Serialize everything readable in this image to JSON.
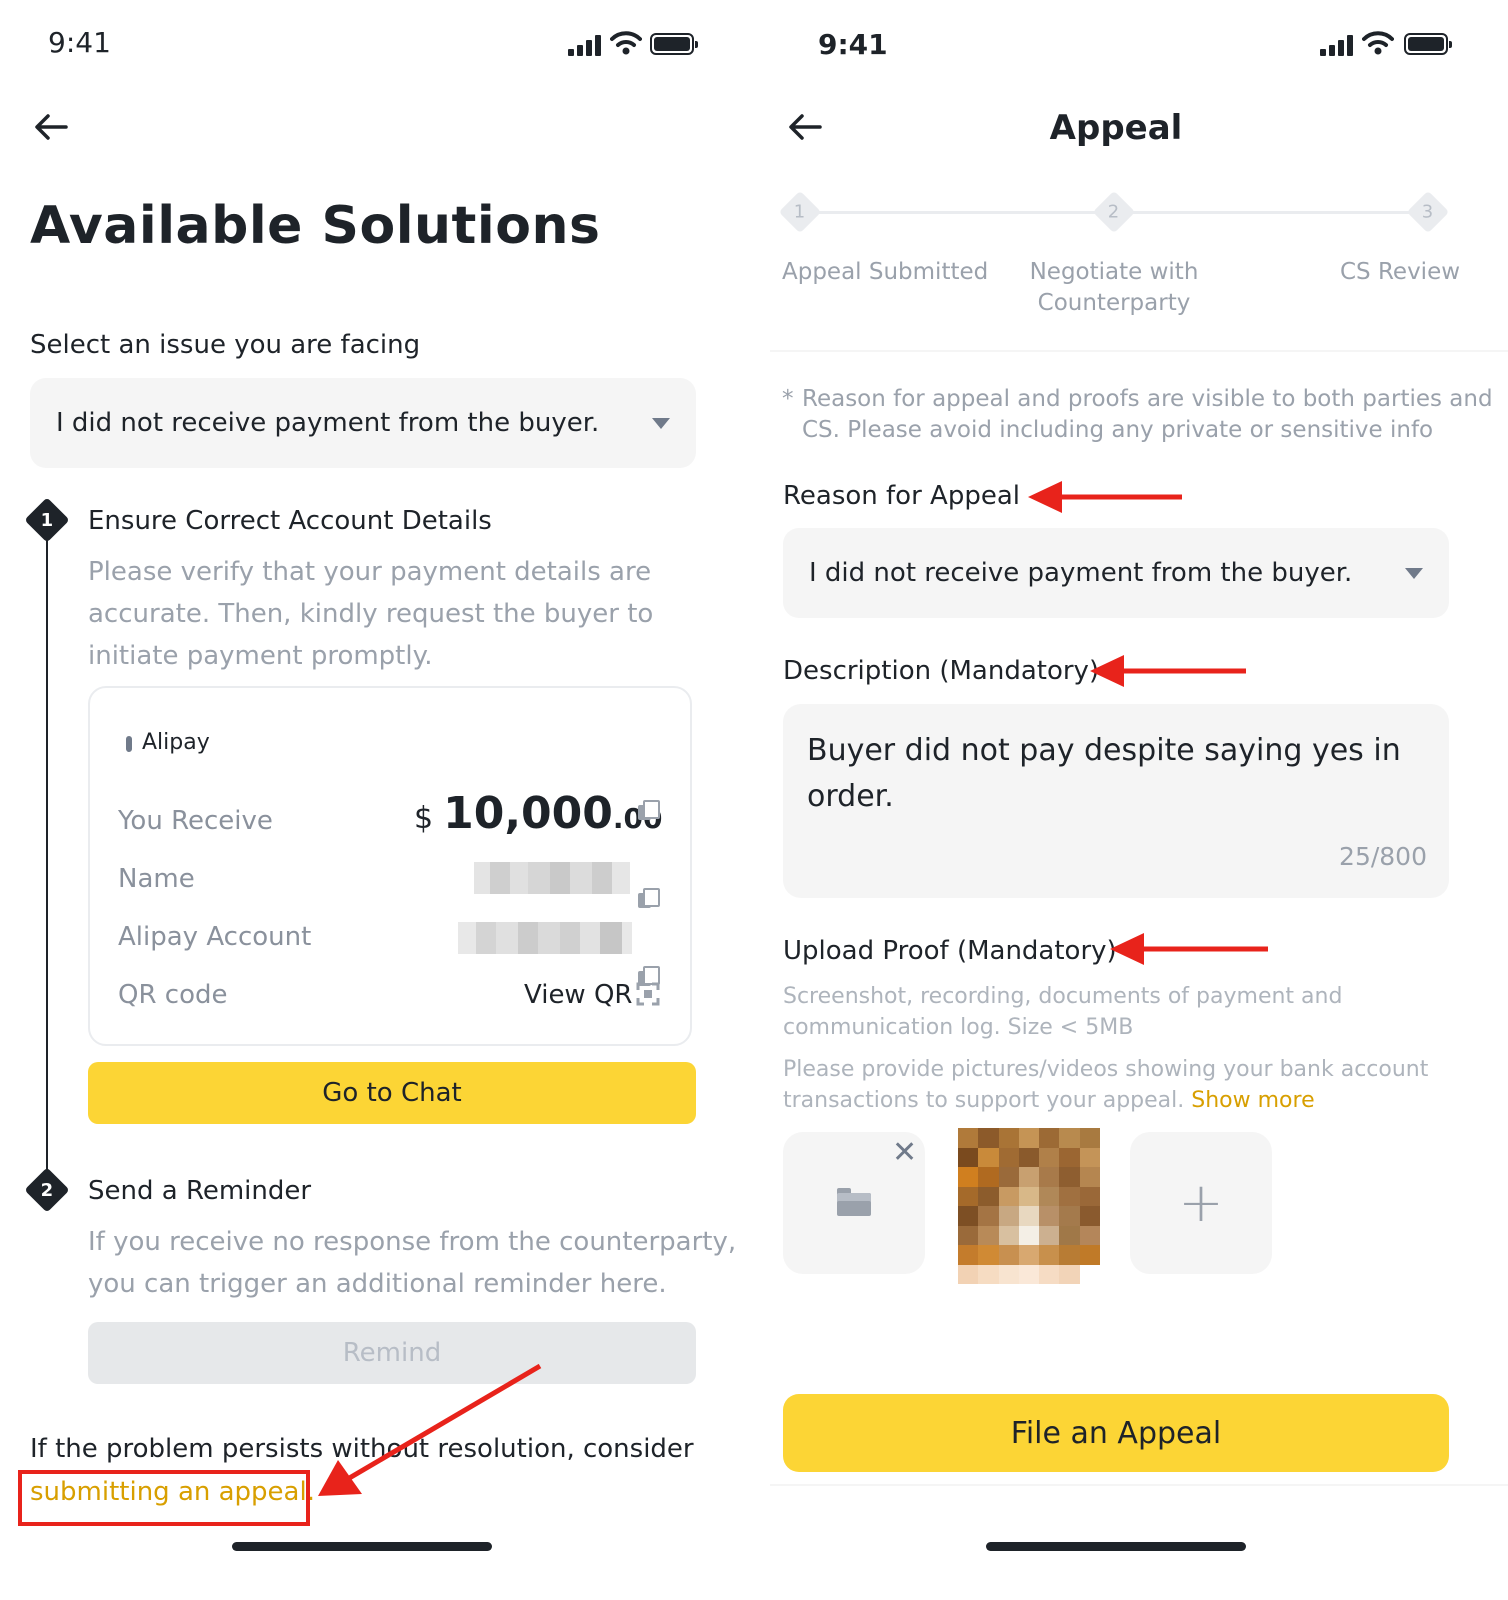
{
  "left": {
    "status_time": "9:41",
    "page_title": "Available Solutions",
    "select_label": "Select an issue you are facing",
    "selected_issue": "I did not receive payment from the buyer.",
    "step1": {
      "number": "1",
      "title": "Ensure Correct Account Details",
      "desc_line1": "Please verify that your payment details are",
      "desc_line2": "accurate. Then, kindly request the buyer to",
      "desc_line3": "initiate payment promptly."
    },
    "payment_card": {
      "method": "Alipay",
      "rows": [
        {
          "label": "You Receive"
        },
        {
          "label": "Name"
        },
        {
          "label": "Alipay Account"
        },
        {
          "label": "QR code"
        }
      ],
      "amount_currency": "$",
      "amount_main": "10,000",
      "amount_decimal": ".00",
      "view_qr_label": "View QR"
    },
    "go_to_chat_label": "Go to Chat",
    "step2": {
      "number": "2",
      "title": "Send a Reminder",
      "desc_line1": "If you receive no response from the counterparty,",
      "desc_line2": "you can trigger an additional reminder here."
    },
    "remind_label": "Remind",
    "footer_text": "If the problem persists without resolution, consider",
    "appeal_link": "submitting an appeal.",
    "annotation_color": "#e8231b"
  },
  "right": {
    "status_time": "9:41",
    "title": "Appeal",
    "progress_steps": [
      {
        "number": "1",
        "label_line1": "Appeal Submitted",
        "label_line2": ""
      },
      {
        "number": "2",
        "label_line1": "Negotiate with",
        "label_line2": "Counterparty"
      },
      {
        "number": "3",
        "label_line1": "CS Review",
        "label_line2": ""
      }
    ],
    "note_star": "*",
    "note_line1": "Reason for appeal and proofs are visible to both parties and",
    "note_line2": "CS. Please avoid including any private or sensitive info",
    "reason_label": "Reason for Appeal",
    "reason_value": "I did not receive payment from the buyer.",
    "description_label": "Description (Mandatory)",
    "description_line1": "Buyer did not pay despite saying yes in",
    "description_line2": "order.",
    "char_count": "25/800",
    "upload_label": "Upload Proof (Mandatory)",
    "upload_hint_line1": "Screenshot, recording, documents of payment and",
    "upload_hint_line2": "communication log. Size < 5MB",
    "upload_tip_line1": "Please provide pictures/videos showing your bank account",
    "upload_tip_line2": "transactions to support your appeal.",
    "show_more": "Show more",
    "close_symbol": "✕",
    "plus_symbol": "+",
    "file_appeal_label": "File an Appeal",
    "accent_color": "#fcd535",
    "link_color": "#d89f00"
  }
}
